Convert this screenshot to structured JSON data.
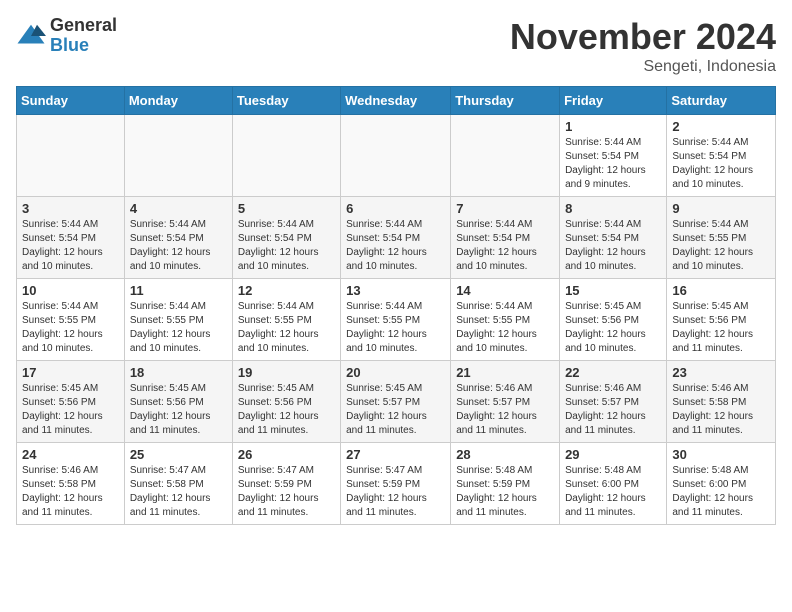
{
  "logo": {
    "general": "General",
    "blue": "Blue"
  },
  "title": "November 2024",
  "subtitle": "Sengeti, Indonesia",
  "days_header": [
    "Sunday",
    "Monday",
    "Tuesday",
    "Wednesday",
    "Thursday",
    "Friday",
    "Saturday"
  ],
  "weeks": [
    [
      {
        "day": "",
        "info": ""
      },
      {
        "day": "",
        "info": ""
      },
      {
        "day": "",
        "info": ""
      },
      {
        "day": "",
        "info": ""
      },
      {
        "day": "",
        "info": ""
      },
      {
        "day": "1",
        "info": "Sunrise: 5:44 AM\nSunset: 5:54 PM\nDaylight: 12 hours\nand 9 minutes."
      },
      {
        "day": "2",
        "info": "Sunrise: 5:44 AM\nSunset: 5:54 PM\nDaylight: 12 hours\nand 10 minutes."
      }
    ],
    [
      {
        "day": "3",
        "info": "Sunrise: 5:44 AM\nSunset: 5:54 PM\nDaylight: 12 hours\nand 10 minutes."
      },
      {
        "day": "4",
        "info": "Sunrise: 5:44 AM\nSunset: 5:54 PM\nDaylight: 12 hours\nand 10 minutes."
      },
      {
        "day": "5",
        "info": "Sunrise: 5:44 AM\nSunset: 5:54 PM\nDaylight: 12 hours\nand 10 minutes."
      },
      {
        "day": "6",
        "info": "Sunrise: 5:44 AM\nSunset: 5:54 PM\nDaylight: 12 hours\nand 10 minutes."
      },
      {
        "day": "7",
        "info": "Sunrise: 5:44 AM\nSunset: 5:54 PM\nDaylight: 12 hours\nand 10 minutes."
      },
      {
        "day": "8",
        "info": "Sunrise: 5:44 AM\nSunset: 5:54 PM\nDaylight: 12 hours\nand 10 minutes."
      },
      {
        "day": "9",
        "info": "Sunrise: 5:44 AM\nSunset: 5:55 PM\nDaylight: 12 hours\nand 10 minutes."
      }
    ],
    [
      {
        "day": "10",
        "info": "Sunrise: 5:44 AM\nSunset: 5:55 PM\nDaylight: 12 hours\nand 10 minutes."
      },
      {
        "day": "11",
        "info": "Sunrise: 5:44 AM\nSunset: 5:55 PM\nDaylight: 12 hours\nand 10 minutes."
      },
      {
        "day": "12",
        "info": "Sunrise: 5:44 AM\nSunset: 5:55 PM\nDaylight: 12 hours\nand 10 minutes."
      },
      {
        "day": "13",
        "info": "Sunrise: 5:44 AM\nSunset: 5:55 PM\nDaylight: 12 hours\nand 10 minutes."
      },
      {
        "day": "14",
        "info": "Sunrise: 5:44 AM\nSunset: 5:55 PM\nDaylight: 12 hours\nand 10 minutes."
      },
      {
        "day": "15",
        "info": "Sunrise: 5:45 AM\nSunset: 5:56 PM\nDaylight: 12 hours\nand 10 minutes."
      },
      {
        "day": "16",
        "info": "Sunrise: 5:45 AM\nSunset: 5:56 PM\nDaylight: 12 hours\nand 11 minutes."
      }
    ],
    [
      {
        "day": "17",
        "info": "Sunrise: 5:45 AM\nSunset: 5:56 PM\nDaylight: 12 hours\nand 11 minutes."
      },
      {
        "day": "18",
        "info": "Sunrise: 5:45 AM\nSunset: 5:56 PM\nDaylight: 12 hours\nand 11 minutes."
      },
      {
        "day": "19",
        "info": "Sunrise: 5:45 AM\nSunset: 5:56 PM\nDaylight: 12 hours\nand 11 minutes."
      },
      {
        "day": "20",
        "info": "Sunrise: 5:45 AM\nSunset: 5:57 PM\nDaylight: 12 hours\nand 11 minutes."
      },
      {
        "day": "21",
        "info": "Sunrise: 5:46 AM\nSunset: 5:57 PM\nDaylight: 12 hours\nand 11 minutes."
      },
      {
        "day": "22",
        "info": "Sunrise: 5:46 AM\nSunset: 5:57 PM\nDaylight: 12 hours\nand 11 minutes."
      },
      {
        "day": "23",
        "info": "Sunrise: 5:46 AM\nSunset: 5:58 PM\nDaylight: 12 hours\nand 11 minutes."
      }
    ],
    [
      {
        "day": "24",
        "info": "Sunrise: 5:46 AM\nSunset: 5:58 PM\nDaylight: 12 hours\nand 11 minutes."
      },
      {
        "day": "25",
        "info": "Sunrise: 5:47 AM\nSunset: 5:58 PM\nDaylight: 12 hours\nand 11 minutes."
      },
      {
        "day": "26",
        "info": "Sunrise: 5:47 AM\nSunset: 5:59 PM\nDaylight: 12 hours\nand 11 minutes."
      },
      {
        "day": "27",
        "info": "Sunrise: 5:47 AM\nSunset: 5:59 PM\nDaylight: 12 hours\nand 11 minutes."
      },
      {
        "day": "28",
        "info": "Sunrise: 5:48 AM\nSunset: 5:59 PM\nDaylight: 12 hours\nand 11 minutes."
      },
      {
        "day": "29",
        "info": "Sunrise: 5:48 AM\nSunset: 6:00 PM\nDaylight: 12 hours\nand 11 minutes."
      },
      {
        "day": "30",
        "info": "Sunrise: 5:48 AM\nSunset: 6:00 PM\nDaylight: 12 hours\nand 11 minutes."
      }
    ]
  ]
}
